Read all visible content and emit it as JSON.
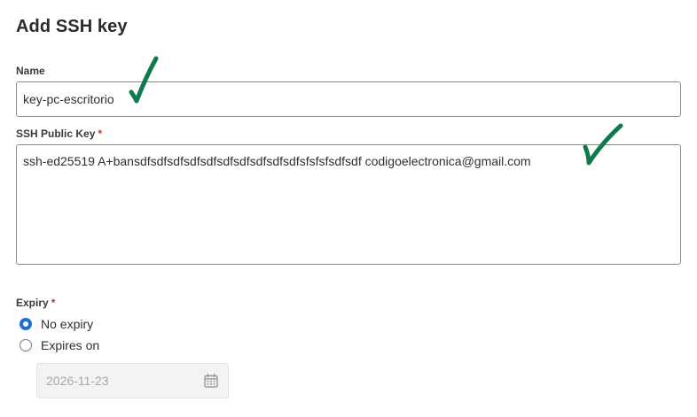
{
  "form": {
    "title": "Add SSH key",
    "name_label": "Name",
    "name_value": "key-pc-escritorio",
    "key_label": "SSH Public Key",
    "key_value": "ssh-ed25519 A+bansdfsdfsdfsdfsdfsdfsdfsdfsdfsdfsfsfsfsdfsdf codigoelectronica@gmail.com",
    "required_mark": "*",
    "expiry_label": "Expiry",
    "expiry_options": [
      {
        "label": "No expiry",
        "selected": true
      },
      {
        "label": "Expires on",
        "selected": false
      }
    ],
    "expiry_date": "2026-11-23"
  },
  "annotations": {
    "checkmark_color": "#0f7a4d"
  },
  "colors": {
    "accent": "#1f6fd6",
    "required": "#c0392b"
  }
}
